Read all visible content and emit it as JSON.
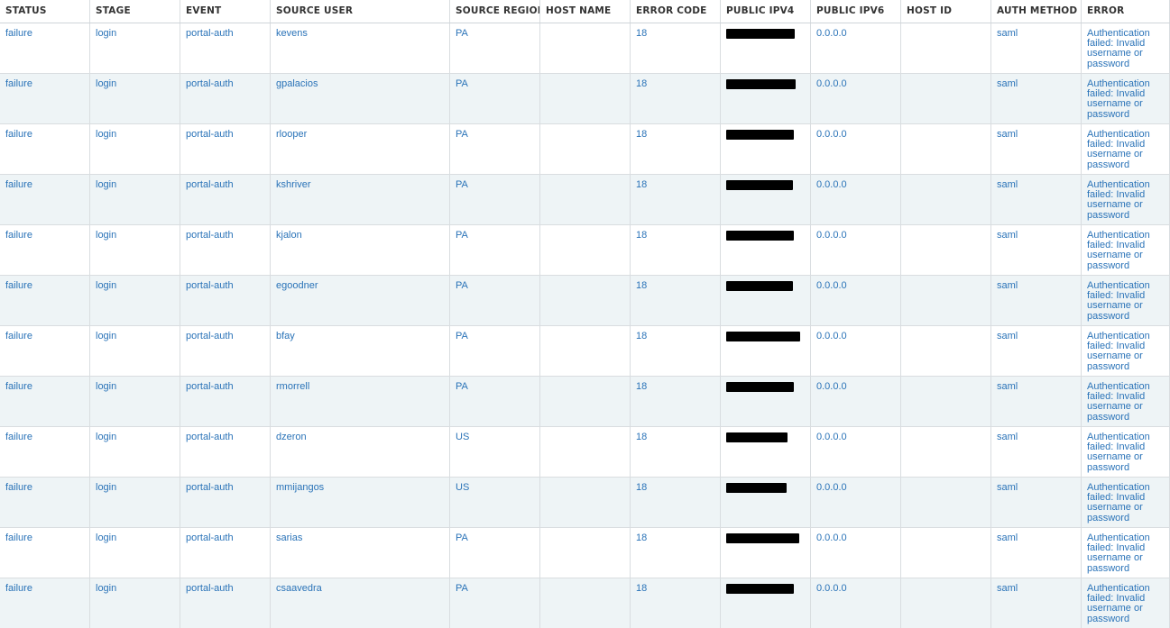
{
  "columns": [
    "STATUS",
    "STAGE",
    "EVENT",
    "SOURCE USER",
    "SOURCE REGION",
    "HOST NAME",
    "ERROR CODE",
    "PUBLIC IPV4",
    "PUBLIC IPV6",
    "HOST ID",
    "AUTH METHOD",
    "ERROR"
  ],
  "rows": [
    {
      "status": "failure",
      "stage": "login",
      "event": "portal-auth",
      "source_user": "kevens",
      "source_region": "PA",
      "host_name": "",
      "error_code": "18",
      "public_ipv4_redacted": true,
      "public_ipv6": "0.0.0.0",
      "host_id": "",
      "auth_method": "saml",
      "error": "Authentication failed: Invalid username or password"
    },
    {
      "status": "failure",
      "stage": "login",
      "event": "portal-auth",
      "source_user": "gpalacios",
      "source_region": "PA",
      "host_name": "",
      "error_code": "18",
      "public_ipv4_redacted": true,
      "public_ipv6": "0.0.0.0",
      "host_id": "",
      "auth_method": "saml",
      "error": "Authentication failed: Invalid username or password"
    },
    {
      "status": "failure",
      "stage": "login",
      "event": "portal-auth",
      "source_user": "rlooper",
      "source_region": "PA",
      "host_name": "",
      "error_code": "18",
      "public_ipv4_redacted": true,
      "public_ipv6": "0.0.0.0",
      "host_id": "",
      "auth_method": "saml",
      "error": "Authentication failed: Invalid username or password"
    },
    {
      "status": "failure",
      "stage": "login",
      "event": "portal-auth",
      "source_user": "kshriver",
      "source_region": "PA",
      "host_name": "",
      "error_code": "18",
      "public_ipv4_redacted": true,
      "public_ipv6": "0.0.0.0",
      "host_id": "",
      "auth_method": "saml",
      "error": "Authentication failed: Invalid username or password"
    },
    {
      "status": "failure",
      "stage": "login",
      "event": "portal-auth",
      "source_user": "kjalon",
      "source_region": "PA",
      "host_name": "",
      "error_code": "18",
      "public_ipv4_redacted": true,
      "public_ipv6": "0.0.0.0",
      "host_id": "",
      "auth_method": "saml",
      "error": "Authentication failed: Invalid username or password"
    },
    {
      "status": "failure",
      "stage": "login",
      "event": "portal-auth",
      "source_user": "egoodner",
      "source_region": "PA",
      "host_name": "",
      "error_code": "18",
      "public_ipv4_redacted": true,
      "public_ipv6": "0.0.0.0",
      "host_id": "",
      "auth_method": "saml",
      "error": "Authentication failed: Invalid username or password"
    },
    {
      "status": "failure",
      "stage": "login",
      "event": "portal-auth",
      "source_user": "bfay",
      "source_region": "PA",
      "host_name": "",
      "error_code": "18",
      "public_ipv4_redacted": true,
      "public_ipv6": "0.0.0.0",
      "host_id": "",
      "auth_method": "saml",
      "error": "Authentication failed: Invalid username or password"
    },
    {
      "status": "failure",
      "stage": "login",
      "event": "portal-auth",
      "source_user": "rmorrell",
      "source_region": "PA",
      "host_name": "",
      "error_code": "18",
      "public_ipv4_redacted": true,
      "public_ipv6": "0.0.0.0",
      "host_id": "",
      "auth_method": "saml",
      "error": "Authentication failed: Invalid username or password"
    },
    {
      "status": "failure",
      "stage": "login",
      "event": "portal-auth",
      "source_user": "dzeron",
      "source_region": "US",
      "host_name": "",
      "error_code": "18",
      "public_ipv4_redacted": true,
      "public_ipv6": "0.0.0.0",
      "host_id": "",
      "auth_method": "saml",
      "error": "Authentication failed: Invalid username or password"
    },
    {
      "status": "failure",
      "stage": "login",
      "event": "portal-auth",
      "source_user": "mmijangos",
      "source_region": "US",
      "host_name": "",
      "error_code": "18",
      "public_ipv4_redacted": true,
      "public_ipv6": "0.0.0.0",
      "host_id": "",
      "auth_method": "saml",
      "error": "Authentication failed: Invalid username or password"
    },
    {
      "status": "failure",
      "stage": "login",
      "event": "portal-auth",
      "source_user": "sarias",
      "source_region": "PA",
      "host_name": "",
      "error_code": "18",
      "public_ipv4_redacted": true,
      "public_ipv6": "0.0.0.0",
      "host_id": "",
      "auth_method": "saml",
      "error": "Authentication failed: Invalid username or password"
    },
    {
      "status": "failure",
      "stage": "login",
      "event": "portal-auth",
      "source_user": "csaavedra",
      "source_region": "PA",
      "host_name": "",
      "error_code": "18",
      "public_ipv4_redacted": true,
      "public_ipv6": "0.0.0.0",
      "host_id": "",
      "auth_method": "saml",
      "error": "Authentication failed: Invalid username or password"
    }
  ],
  "colors": {
    "link": "#2a73b8",
    "header_text": "#333333",
    "row_alt_bg": "#eef4f6",
    "grid_line": "#d9dde0",
    "redaction": "#000000"
  }
}
